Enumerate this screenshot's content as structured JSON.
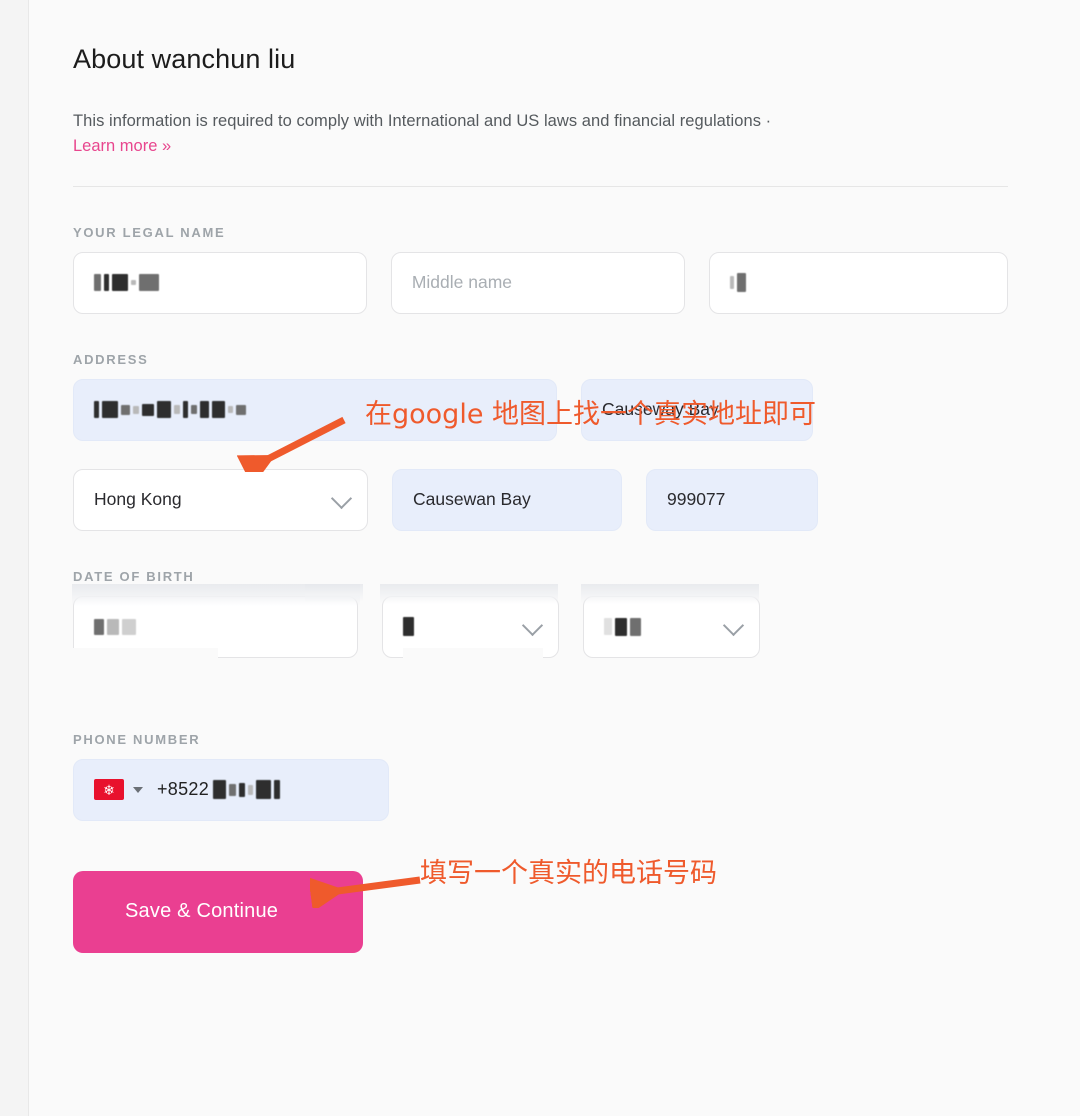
{
  "header": {
    "title": "About wanchun liu",
    "description": "This information is required to comply with International and US laws and financial regulations ·",
    "learn_more": "Learn more »"
  },
  "sections": {
    "legal_name": {
      "label": "YOUR LEGAL NAME",
      "first_name_value": "",
      "middle_name_placeholder": "Middle name",
      "last_name_value": ""
    },
    "address": {
      "label": "ADDRESS",
      "street_value": "",
      "street2_value": "Causeway Bay",
      "country_value": "Hong Kong",
      "city_value": "Causewan Bay",
      "postal_value": "999077"
    },
    "date_of_birth": {
      "label": "DATE OF BIRTH",
      "day_value": "",
      "month_value": "",
      "year_value": ""
    },
    "phone": {
      "label": "PHONE NUMBER",
      "country_code": "+8522",
      "number_value": ""
    }
  },
  "actions": {
    "save_continue": "Save & Continue"
  },
  "annotations": {
    "address_note": "在google 地图上找一个真实地址即可",
    "phone_note": "填写一个真实的电话号码"
  },
  "colors": {
    "accent_pink": "#ea3f91",
    "link_pink": "#e8468e",
    "annotation_orange": "#ef5a2c",
    "autofill_blue": "#e8eefb"
  }
}
